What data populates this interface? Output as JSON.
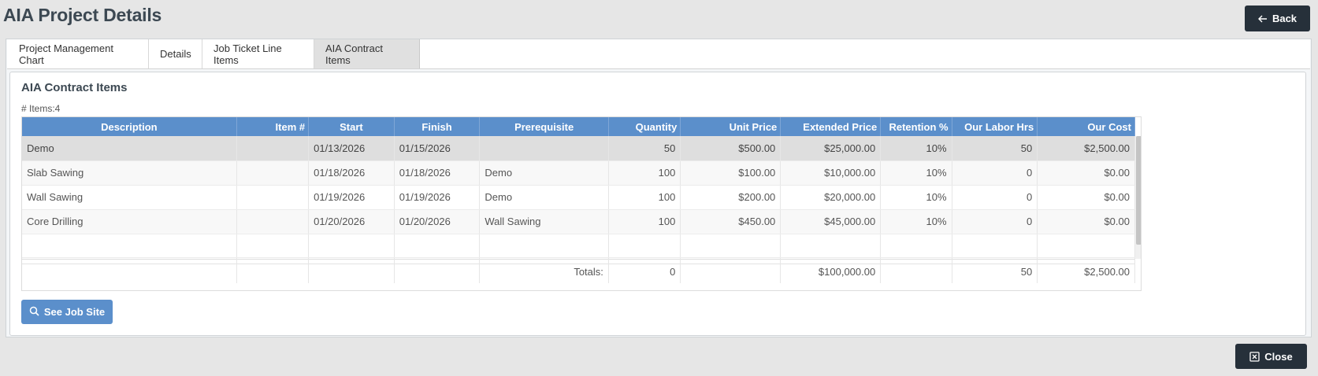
{
  "header": {
    "title": "AIA Project Details",
    "back_label": "Back"
  },
  "tabs": [
    {
      "label": "Project Management Chart"
    },
    {
      "label": "Details"
    },
    {
      "label": "Job Ticket Line Items"
    },
    {
      "label": "AIA Contract Items",
      "active": true
    }
  ],
  "panel": {
    "title": "AIA Contract Items",
    "items_count": "# Items:4"
  },
  "grid": {
    "columns": [
      "Description",
      "Item #",
      "Start",
      "Finish",
      "Prerequisite",
      "Quantity",
      "Unit Price",
      "Extended Price",
      "Retention %",
      "Our Labor Hrs",
      "Our Cost"
    ],
    "rows": [
      {
        "description": "Demo",
        "item": "",
        "start": "01/13/2026",
        "finish": "01/15/2026",
        "prerequisite": "",
        "quantity": "50",
        "unit_price": "$500.00",
        "extended_price": "$25,000.00",
        "retention": "10%",
        "labor_hrs": "50",
        "our_cost": "$2,500.00"
      },
      {
        "description": "Slab Sawing",
        "item": "",
        "start": "01/18/2026",
        "finish": "01/18/2026",
        "prerequisite": "Demo",
        "quantity": "100",
        "unit_price": "$100.00",
        "extended_price": "$10,000.00",
        "retention": "10%",
        "labor_hrs": "0",
        "our_cost": "$0.00"
      },
      {
        "description": "Wall Sawing",
        "item": "",
        "start": "01/19/2026",
        "finish": "01/19/2026",
        "prerequisite": "Demo",
        "quantity": "100",
        "unit_price": "$200.00",
        "extended_price": "$20,000.00",
        "retention": "10%",
        "labor_hrs": "0",
        "our_cost": "$0.00"
      },
      {
        "description": "Core Drilling",
        "item": "",
        "start": "01/20/2026",
        "finish": "01/20/2026",
        "prerequisite": "Wall Sawing",
        "quantity": "100",
        "unit_price": "$450.00",
        "extended_price": "$45,000.00",
        "retention": "10%",
        "labor_hrs": "0",
        "our_cost": "$0.00"
      }
    ],
    "totals": {
      "label": "Totals:",
      "quantity": "0",
      "extended_price": "$100,000.00",
      "labor_hrs": "50",
      "our_cost": "$2,500.00"
    }
  },
  "actions": {
    "see_job_site": "See Job Site",
    "close": "Close"
  },
  "icons": {
    "back": "arrow-left-icon",
    "search": "search-icon",
    "close": "close-box-icon"
  },
  "colors": {
    "header_blue": "#5b8fcb",
    "dark_button": "#26303a",
    "selected_row": "#dedede"
  }
}
